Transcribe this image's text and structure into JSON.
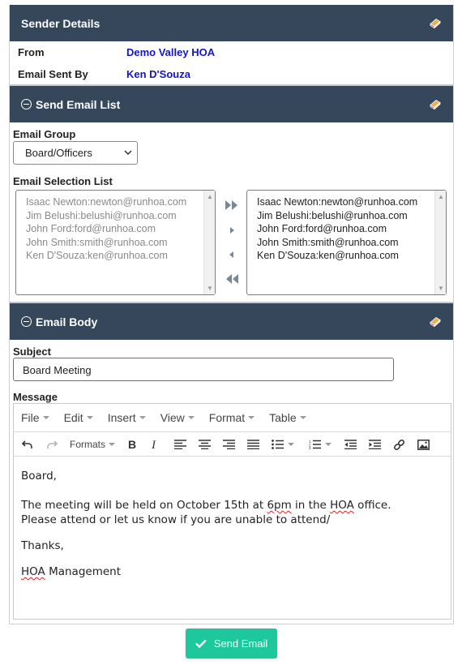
{
  "sender": {
    "title": "Sender Details",
    "from_label": "From",
    "from_value": "Demo Valley HOA",
    "sent_by_label": "Email Sent By",
    "sent_by_value": "Ken D'Souza"
  },
  "email_list": {
    "title": "Send Email List",
    "group_label": "Email Group",
    "group_selected": "Board/Officers",
    "selection_label": "Email Selection List",
    "available": [
      "Isaac Newton:newton@runhoa.com",
      "Jim Belushi:belushi@runhoa.com",
      "John Ford:ford@runhoa.com",
      "John Smith:smith@runhoa.com",
      "Ken D'Souza:ken@runhoa.com"
    ],
    "selected": [
      "Isaac Newton:newton@runhoa.com",
      "Jim Belushi:belushi@runhoa.com",
      "John Ford:ford@runhoa.com",
      "John Smith:smith@runhoa.com",
      "Ken D'Souza:ken@runhoa.com"
    ]
  },
  "email_body": {
    "title": "Email Body",
    "subject_label": "Subject",
    "subject_value": "Board Meeting",
    "message_label": "Message",
    "menu": [
      "File",
      "Edit",
      "Insert",
      "View",
      "Format",
      "Table"
    ],
    "formats_label": "Formats",
    "message": {
      "greeting": "Board,",
      "line1_a": "The meeting will be held on October 15th at ",
      "line1_b": "6pm",
      "line1_c": " in the ",
      "line1_d": "HOA",
      "line1_e": " office.",
      "line2": "Please attend or let us know if you are unable to attend/",
      "closing": "Thanks,",
      "sig_a": "HOA",
      "sig_b": " Management"
    }
  },
  "send_button": "Send Email",
  "colors": {
    "header_bg": "#36475c",
    "link_blue": "#1414c8",
    "send_green": "#1dc99c"
  },
  "icons": {
    "panel_book": "book-icon",
    "collapse": "minus-circle-icon",
    "send": "check-icon"
  }
}
